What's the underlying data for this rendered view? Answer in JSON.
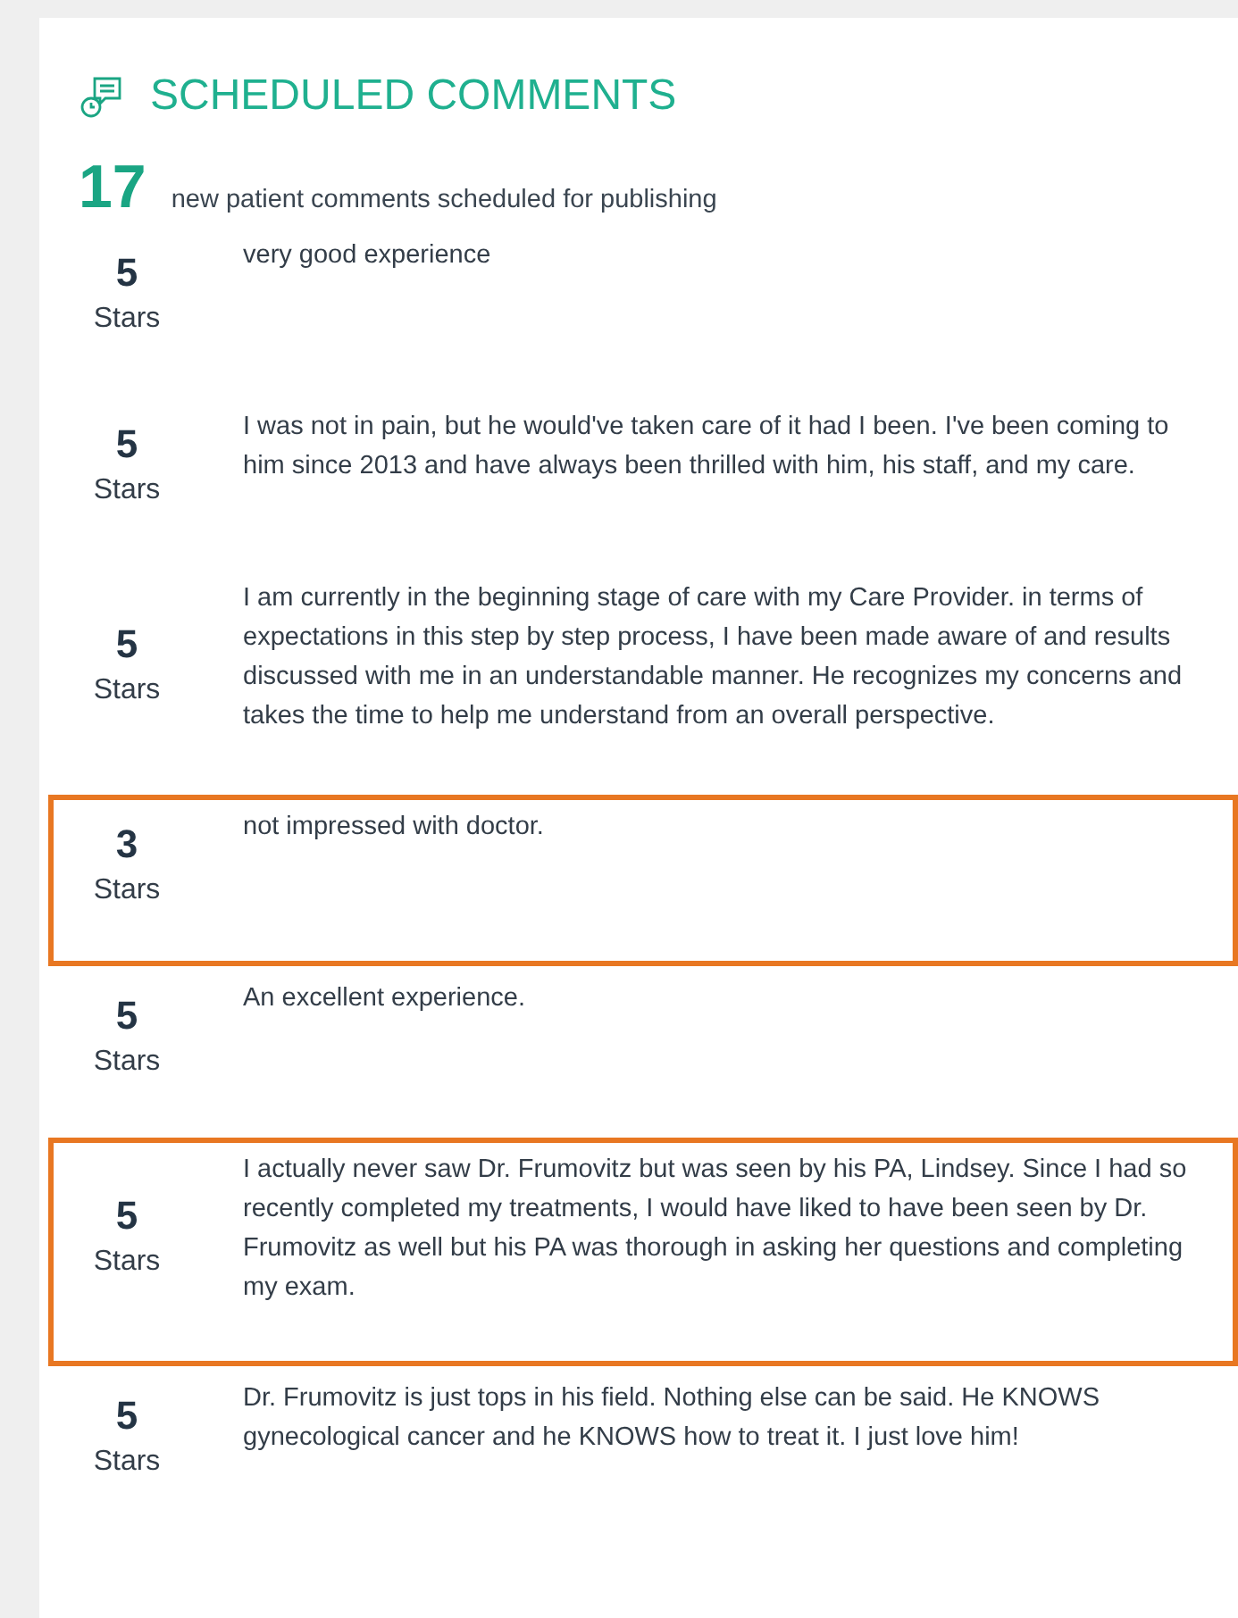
{
  "header": {
    "title": "SCHEDULED COMMENTS"
  },
  "summary": {
    "count": "17",
    "text": "new patient comments scheduled for publishing"
  },
  "comments": [
    {
      "rating": "5",
      "unit": "Stars",
      "text": "very good experience",
      "highlighted": false
    },
    {
      "rating": "5",
      "unit": "Stars",
      "text": "I was not in pain, but he would've taken care of it had I been. I've been coming to him since 2013 and have always been thrilled with him, his staff, and my care.",
      "highlighted": false
    },
    {
      "rating": "5",
      "unit": "Stars",
      "text": "I am currently in the beginning stage of care with my Care Provider. in terms of expectations in this step by step process, I have been made aware of and results discussed with me in an understandable manner. He recognizes my concerns and takes the time to help me understand from an overall perspective.",
      "highlighted": false
    },
    {
      "rating": "3",
      "unit": "Stars",
      "text": "not impressed with doctor.",
      "highlighted": true
    },
    {
      "rating": "5",
      "unit": "Stars",
      "text": "An excellent experience.",
      "highlighted": false
    },
    {
      "rating": "5",
      "unit": "Stars",
      "text": "I actually never saw Dr. Frumovitz but was seen by his PA, Lindsey. Since I had so recently completed my treatments, I would have liked to have been seen by Dr. Frumovitz as well but his PA was thorough in asking her questions and completing my exam.",
      "highlighted": true
    },
    {
      "rating": "5",
      "unit": "Stars",
      "text": "Dr. Frumovitz is just tops in his field. Nothing else can be said. He KNOWS gynecological cancer and he KNOWS how to treat it. I just love him!",
      "highlighted": false
    }
  ]
}
